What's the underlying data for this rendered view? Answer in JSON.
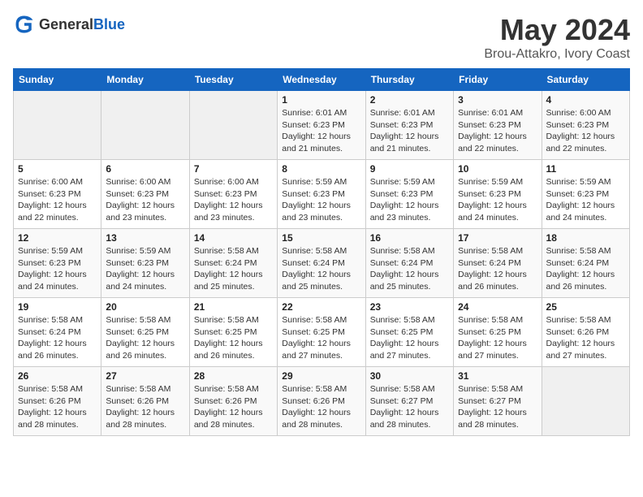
{
  "header": {
    "logo_general": "General",
    "logo_blue": "Blue",
    "month": "May 2024",
    "location": "Brou-Attakro, Ivory Coast"
  },
  "weekdays": [
    "Sunday",
    "Monday",
    "Tuesday",
    "Wednesday",
    "Thursday",
    "Friday",
    "Saturday"
  ],
  "weeks": [
    [
      {
        "day": "",
        "info": ""
      },
      {
        "day": "",
        "info": ""
      },
      {
        "day": "",
        "info": ""
      },
      {
        "day": "1",
        "info": "Sunrise: 6:01 AM\nSunset: 6:23 PM\nDaylight: 12 hours\nand 21 minutes."
      },
      {
        "day": "2",
        "info": "Sunrise: 6:01 AM\nSunset: 6:23 PM\nDaylight: 12 hours\nand 21 minutes."
      },
      {
        "day": "3",
        "info": "Sunrise: 6:01 AM\nSunset: 6:23 PM\nDaylight: 12 hours\nand 22 minutes."
      },
      {
        "day": "4",
        "info": "Sunrise: 6:00 AM\nSunset: 6:23 PM\nDaylight: 12 hours\nand 22 minutes."
      }
    ],
    [
      {
        "day": "5",
        "info": "Sunrise: 6:00 AM\nSunset: 6:23 PM\nDaylight: 12 hours\nand 22 minutes."
      },
      {
        "day": "6",
        "info": "Sunrise: 6:00 AM\nSunset: 6:23 PM\nDaylight: 12 hours\nand 23 minutes."
      },
      {
        "day": "7",
        "info": "Sunrise: 6:00 AM\nSunset: 6:23 PM\nDaylight: 12 hours\nand 23 minutes."
      },
      {
        "day": "8",
        "info": "Sunrise: 5:59 AM\nSunset: 6:23 PM\nDaylight: 12 hours\nand 23 minutes."
      },
      {
        "day": "9",
        "info": "Sunrise: 5:59 AM\nSunset: 6:23 PM\nDaylight: 12 hours\nand 23 minutes."
      },
      {
        "day": "10",
        "info": "Sunrise: 5:59 AM\nSunset: 6:23 PM\nDaylight: 12 hours\nand 24 minutes."
      },
      {
        "day": "11",
        "info": "Sunrise: 5:59 AM\nSunset: 6:23 PM\nDaylight: 12 hours\nand 24 minutes."
      }
    ],
    [
      {
        "day": "12",
        "info": "Sunrise: 5:59 AM\nSunset: 6:23 PM\nDaylight: 12 hours\nand 24 minutes."
      },
      {
        "day": "13",
        "info": "Sunrise: 5:59 AM\nSunset: 6:23 PM\nDaylight: 12 hours\nand 24 minutes."
      },
      {
        "day": "14",
        "info": "Sunrise: 5:58 AM\nSunset: 6:24 PM\nDaylight: 12 hours\nand 25 minutes."
      },
      {
        "day": "15",
        "info": "Sunrise: 5:58 AM\nSunset: 6:24 PM\nDaylight: 12 hours\nand 25 minutes."
      },
      {
        "day": "16",
        "info": "Sunrise: 5:58 AM\nSunset: 6:24 PM\nDaylight: 12 hours\nand 25 minutes."
      },
      {
        "day": "17",
        "info": "Sunrise: 5:58 AM\nSunset: 6:24 PM\nDaylight: 12 hours\nand 26 minutes."
      },
      {
        "day": "18",
        "info": "Sunrise: 5:58 AM\nSunset: 6:24 PM\nDaylight: 12 hours\nand 26 minutes."
      }
    ],
    [
      {
        "day": "19",
        "info": "Sunrise: 5:58 AM\nSunset: 6:24 PM\nDaylight: 12 hours\nand 26 minutes."
      },
      {
        "day": "20",
        "info": "Sunrise: 5:58 AM\nSunset: 6:25 PM\nDaylight: 12 hours\nand 26 minutes."
      },
      {
        "day": "21",
        "info": "Sunrise: 5:58 AM\nSunset: 6:25 PM\nDaylight: 12 hours\nand 26 minutes."
      },
      {
        "day": "22",
        "info": "Sunrise: 5:58 AM\nSunset: 6:25 PM\nDaylight: 12 hours\nand 27 minutes."
      },
      {
        "day": "23",
        "info": "Sunrise: 5:58 AM\nSunset: 6:25 PM\nDaylight: 12 hours\nand 27 minutes."
      },
      {
        "day": "24",
        "info": "Sunrise: 5:58 AM\nSunset: 6:25 PM\nDaylight: 12 hours\nand 27 minutes."
      },
      {
        "day": "25",
        "info": "Sunrise: 5:58 AM\nSunset: 6:26 PM\nDaylight: 12 hours\nand 27 minutes."
      }
    ],
    [
      {
        "day": "26",
        "info": "Sunrise: 5:58 AM\nSunset: 6:26 PM\nDaylight: 12 hours\nand 28 minutes."
      },
      {
        "day": "27",
        "info": "Sunrise: 5:58 AM\nSunset: 6:26 PM\nDaylight: 12 hours\nand 28 minutes."
      },
      {
        "day": "28",
        "info": "Sunrise: 5:58 AM\nSunset: 6:26 PM\nDaylight: 12 hours\nand 28 minutes."
      },
      {
        "day": "29",
        "info": "Sunrise: 5:58 AM\nSunset: 6:26 PM\nDaylight: 12 hours\nand 28 minutes."
      },
      {
        "day": "30",
        "info": "Sunrise: 5:58 AM\nSunset: 6:27 PM\nDaylight: 12 hours\nand 28 minutes."
      },
      {
        "day": "31",
        "info": "Sunrise: 5:58 AM\nSunset: 6:27 PM\nDaylight: 12 hours\nand 28 minutes."
      },
      {
        "day": "",
        "info": ""
      }
    ]
  ]
}
